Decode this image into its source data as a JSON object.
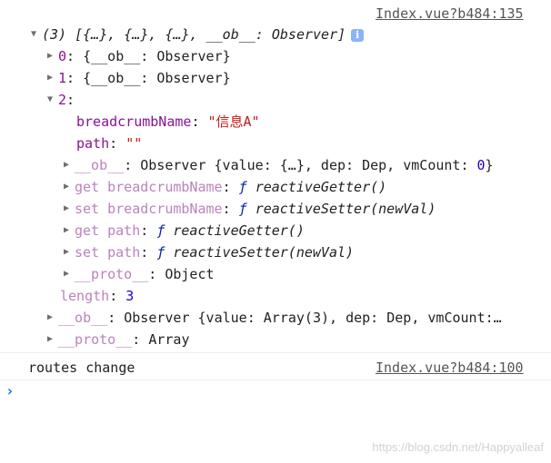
{
  "console": {
    "source_link_1": "Index.vue?b484:135",
    "array_summary": "(3) [{…}, {…}, {…}, __ob__: Observer]",
    "info_icon": "i",
    "items": [
      {
        "key": "0",
        "value": "{__ob__: Observer}"
      },
      {
        "key": "1",
        "value": "{__ob__: Observer}"
      }
    ],
    "item2": {
      "key": "2",
      "breadcrumb_key": "breadcrumbName",
      "breadcrumb_value": "\"信息A\"",
      "path_key": "path",
      "path_value": "\"\"",
      "ob_key": "__ob__",
      "ob_value_prefix": "Observer {value: {…}, dep: Dep, vmCount: ",
      "ob_value_count": "0",
      "ob_value_suffix": "}",
      "getters": [
        {
          "label": "get breadcrumbName",
          "fn_kw": "ƒ",
          "fn": "reactiveGetter()"
        },
        {
          "label": "set breadcrumbName",
          "fn_kw": "ƒ",
          "fn": "reactiveSetter(newVal)"
        },
        {
          "label": "get path",
          "fn_kw": "ƒ",
          "fn": "reactiveGetter()"
        },
        {
          "label": "set path",
          "fn_kw": "ƒ",
          "fn": "reactiveSetter(newVal)"
        }
      ],
      "proto_key": "__proto__",
      "proto_value": "Object"
    },
    "length_key": "length",
    "length_value": "3",
    "array_ob_key": "__ob__",
    "array_ob_value": "Observer {value: Array(3), dep: Dep, vmCount:…",
    "array_proto_key": "__proto__",
    "array_proto_value": "Array",
    "log_message": "routes change",
    "source_link_2": "Index.vue?b484:100",
    "prompt_glyph": "›"
  },
  "watermark": "https://blog.csdn.net/Happyalleaf"
}
